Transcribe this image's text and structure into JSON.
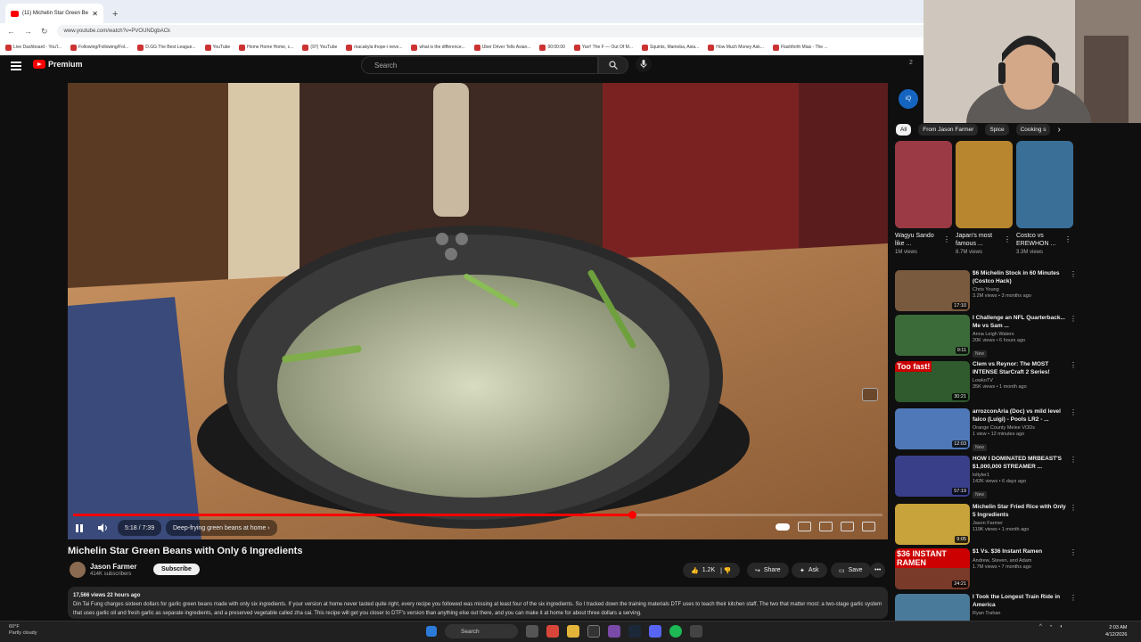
{
  "browser": {
    "tab_title": "(11) Michelin Star Green Be",
    "tab_close": "✕",
    "new_tab": "+",
    "url": "www.youtube.com/watch?v=PVOUNDgbACk",
    "bookmarks": [
      "Live Dashboard - You'l...",
      "Following/Following/Fol...",
      "D.GG The Best League...",
      "YouTube",
      "Home Home Home, c...",
      "(97) YouTube",
      "macakyla thope-i neve...",
      "what is the difference...",
      "Uber Driver Tells Asian...",
      "00:00:00",
      "Yarr! The F — Out Of M...",
      "Squints, Mamoba, Asia...",
      "How Much Money Ask...",
      "Flashforth Mias - The ..."
    ]
  },
  "header": {
    "logo_label": "Premium",
    "search_placeholder": "Search",
    "right_text": "2"
  },
  "player": {
    "time": "5:18 / 7:39",
    "chapter": "Deep-frying green beans at home",
    "progress_fraction": 0.69
  },
  "video": {
    "title": "Michelin Star Green Beans with Only 6 Ingredients",
    "channel": "Jason Farmer",
    "subscribers": "414K subscribers",
    "subscribe_label": "Subscribe",
    "likes": "1.2K",
    "share_label": "Share",
    "ask_label": "Ask",
    "save_label": "Save",
    "more_label": "•••",
    "views_date": "17,566 views  22 hours ago",
    "description_1": "Din Tai Fung charges sixteen dollars for garlic green beans made with only six ingredients. If your version at home never tasted quite right, every recipe you followed was missing at least four of the six ingredients. So I tracked down the training materials DTF uses to teach their kitchen staff.",
    "description_2": "The two that matter most: a two-stage garlic system that uses garlic oil and fresh garlic as separate ingredients, and a preserved vegetable called zha cai. This recipe will get you closer to DTF's version than anything else out there, and you can make it at home for about three dollars a serving."
  },
  "sidebar": {
    "chips": [
      "All",
      "From Jason Farmer",
      "Spice",
      "Cooking s"
    ],
    "chip_arrow": "›",
    "bubble": "iQ",
    "shorts": [
      {
        "title": "Wagyu Sando like ...",
        "views": "1M views",
        "color": "#9b3a44"
      },
      {
        "title": "Japan's most famous ...",
        "views": "8.7M views",
        "color": "#b8862e"
      },
      {
        "title": "Costco vs EREWHON ...",
        "views": "3.3M views",
        "color": "#3a6f98"
      }
    ],
    "recs": [
      {
        "title": "$6 Michelin Stock in 60 Minutes (Costco Hack)",
        "channel": "Chris Young",
        "meta": "3.2M views • 3 months ago",
        "duration": "17:10",
        "overlay": "",
        "color": "#7a5a3e",
        "new": ""
      },
      {
        "title": "I Challenge an NFL Quarterback... Me vs Sam ...",
        "channel": "Anna Leigh Waters",
        "meta": "20K views • 6 hours ago",
        "duration": "9:11",
        "overlay": "",
        "color": "#3c6b3a",
        "new": "New"
      },
      {
        "title": "Clem vs Reynor: The MOST INTENSE StarCraft 2 Series!",
        "channel": "LowkoTV",
        "meta": "35K views • 1 month ago",
        "duration": "30:21",
        "overlay": "Too fast!",
        "color": "#2f5b2e",
        "new": ""
      },
      {
        "title": "arrozconAria (Doc) vs mild level falco (Luigi) - Pools LR2 - ...",
        "channel": "Orange County Melee VODs",
        "meta": "1 view • 12 minutes ago",
        "duration": "12:03",
        "overlay": "",
        "color": "#4e78b8",
        "new": "New"
      },
      {
        "title": "HOW I DOMINATED MRBEAST'S $1,000,000 STREAMER ...",
        "channel": "loltyler1",
        "meta": "142K views • 6 days ago",
        "duration": "57:19",
        "overlay": "",
        "color": "#3a3f8a",
        "new": "New"
      },
      {
        "title": "Michelin Star Fried Rice with Only 5 Ingredients",
        "channel": "Jason Farmer",
        "meta": "119K views • 1 month ago",
        "duration": "9:05",
        "overlay": "",
        "color": "#c8a23a",
        "new": ""
      },
      {
        "title": "$1 Vs. $36 Instant Ramen",
        "channel": "Andrew, Steven, and Adam",
        "meta": "1.7M views • 7 months ago",
        "duration": "24:21",
        "overlay": "$36 INSTANT RAMEN",
        "color": "#7a3a2a",
        "new": ""
      },
      {
        "title": "I Took the Longest Train Ride in America",
        "channel": "Ryan Trahan",
        "meta": "",
        "duration": "",
        "overlay": "",
        "color": "#4a7a9a",
        "new": ""
      }
    ]
  },
  "taskbar": {
    "weather_temp": "60°F",
    "weather_desc": "Partly cloudy",
    "search_label": "Search",
    "time": "2:03 AM",
    "date": "4/12/2026"
  }
}
